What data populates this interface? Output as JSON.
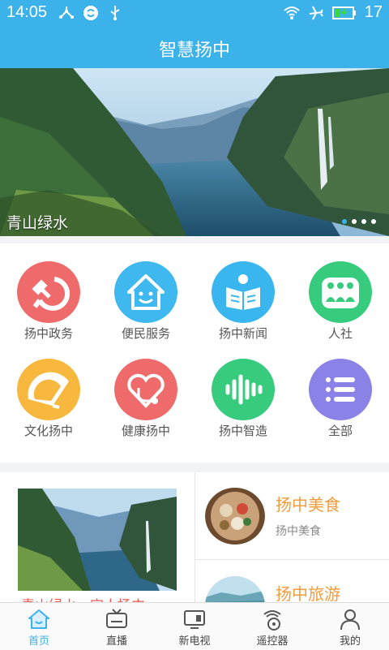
{
  "status_bar": {
    "time": "14:05",
    "battery": "17",
    "icons_left": [
      "usb-share-icon",
      "sync-icon",
      "usb-icon"
    ],
    "icons_right": [
      "wifi-icon",
      "airplane-mode-icon",
      "battery-charging-icon"
    ]
  },
  "header": {
    "title": "智慧扬中"
  },
  "banner": {
    "caption": "青山绿水",
    "page_count": 4,
    "active_page": 1
  },
  "grid": {
    "items": [
      {
        "label": "扬中政务",
        "icon": "hammer-sickle-icon",
        "color": "#ef6b6b"
      },
      {
        "label": "便民服务",
        "icon": "smile-home-icon",
        "color": "#3fb7ef"
      },
      {
        "label": "扬中新闻",
        "icon": "book-reader-icon",
        "color": "#39b6ee"
      },
      {
        "label": "人社",
        "icon": "people-group-icon",
        "color": "#37cb7e"
      },
      {
        "label": "文化扬中",
        "icon": "fan-icon",
        "color": "#f7b83d"
      },
      {
        "label": "健康扬中",
        "icon": "heart-stethoscope-icon",
        "color": "#ef6b6b"
      },
      {
        "label": "扬中智造",
        "icon": "sound-wave-icon",
        "color": "#37cb7e"
      },
      {
        "label": "全部",
        "icon": "list-icon",
        "color": "#8b82e8"
      }
    ]
  },
  "feature": {
    "left_title": "青山绿水，宜人扬中"
  },
  "cards": [
    {
      "title": "扬中美食",
      "subtitle": "扬中美食",
      "accent": "#f39c3c"
    },
    {
      "title": "扬中旅游",
      "accent": "#f39c3c"
    }
  ],
  "tabbar": {
    "active_color": "#3cb2ea",
    "tabs": [
      {
        "label": "首页",
        "icon": "home-icon",
        "active": true
      },
      {
        "label": "直播",
        "icon": "tv-icon",
        "active": false
      },
      {
        "label": "新电视",
        "icon": "new-tv-icon",
        "active": false
      },
      {
        "label": "遥控器",
        "icon": "remote-control-icon",
        "active": false
      },
      {
        "label": "我的",
        "icon": "user-icon",
        "active": false
      }
    ]
  }
}
